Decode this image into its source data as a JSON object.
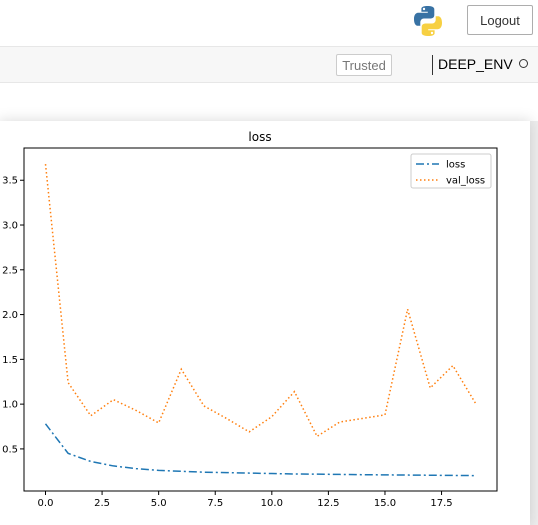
{
  "header": {
    "logo_icon": "python-logo-icon",
    "logout_label": "Logout"
  },
  "toolbar": {
    "trusted_label": "Trusted",
    "kernel_name": "DEEP_ENV",
    "kernel_status_icon": "kernel-idle-circle-icon"
  },
  "colors": {
    "loss": "#1f77b4",
    "val_loss": "#ff7f0e",
    "logo_blue": "#3872a4",
    "logo_yellow": "#f7d042"
  },
  "chart_data": {
    "type": "line",
    "title": "loss",
    "xlabel": "",
    "ylabel": "",
    "x": [
      0,
      1,
      2,
      3,
      4,
      5,
      6,
      7,
      8,
      9,
      10,
      11,
      12,
      13,
      14,
      15,
      16,
      17,
      18,
      19
    ],
    "series": [
      {
        "name": "loss",
        "style": "dash-dot",
        "values": [
          0.78,
          0.45,
          0.36,
          0.31,
          0.28,
          0.26,
          0.25,
          0.24,
          0.235,
          0.23,
          0.225,
          0.22,
          0.218,
          0.215,
          0.212,
          0.21,
          0.208,
          0.206,
          0.204,
          0.202
        ]
      },
      {
        "name": "val_loss",
        "style": "dotted",
        "values": [
          3.68,
          1.24,
          0.87,
          1.05,
          0.93,
          0.79,
          1.39,
          0.98,
          0.84,
          0.69,
          0.86,
          1.14,
          0.64,
          0.8,
          0.84,
          0.88,
          2.06,
          1.18,
          1.43,
          1.01
        ]
      }
    ],
    "xlim": [
      -0.95,
      19.95
    ],
    "ylim": [
      0.03,
      3.86
    ],
    "xticks": [
      "0.0",
      "2.5",
      "5.0",
      "7.5",
      "10.0",
      "12.5",
      "15.0",
      "17.5"
    ],
    "xtick_values": [
      0,
      2.5,
      5,
      7.5,
      10,
      12.5,
      15,
      17.5
    ],
    "yticks": [
      "0.5",
      "1.0",
      "1.5",
      "2.0",
      "2.5",
      "3.0",
      "3.5"
    ],
    "ytick_values": [
      0.5,
      1.0,
      1.5,
      2.0,
      2.5,
      3.0,
      3.5
    ],
    "legend_position": "top-right",
    "grid": false
  }
}
